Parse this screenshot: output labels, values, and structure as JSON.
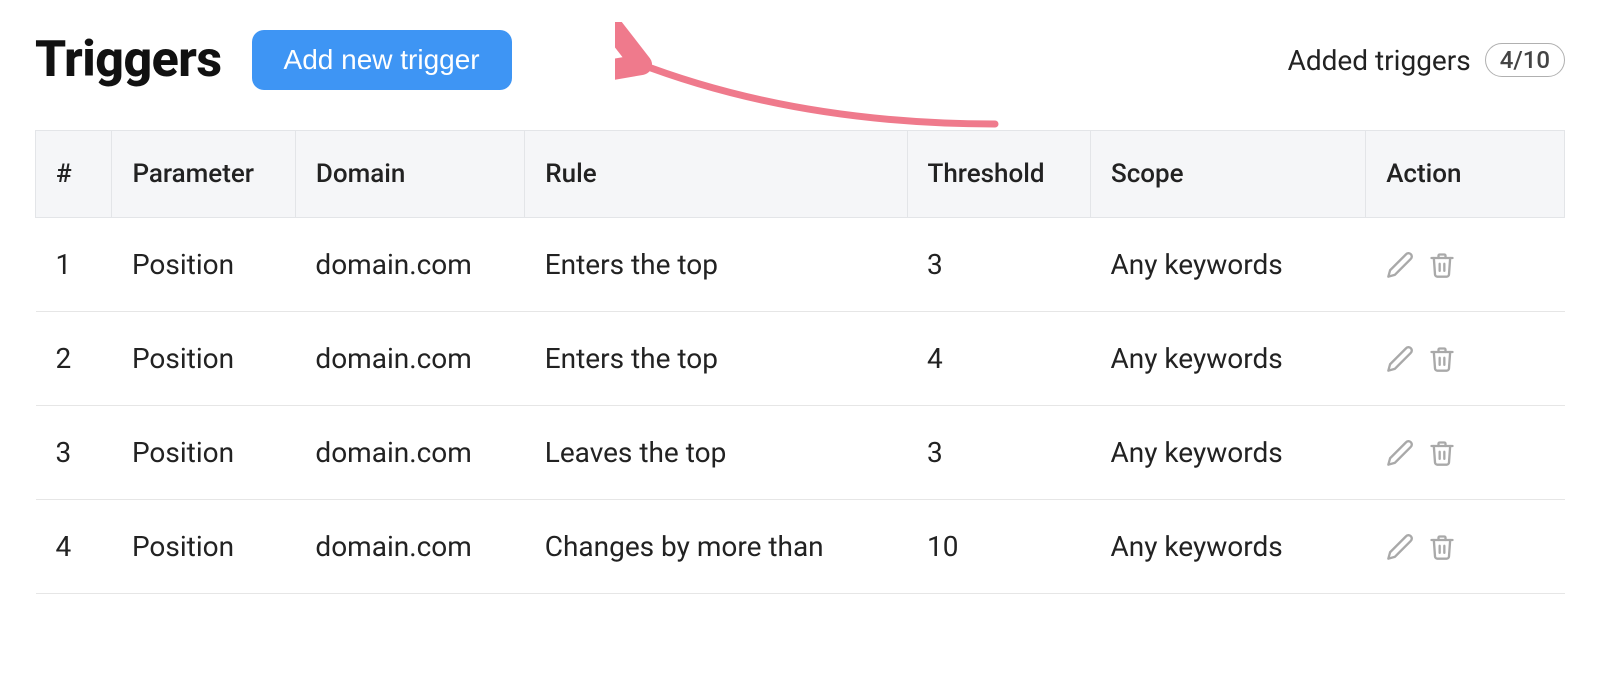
{
  "header": {
    "title": "Triggers",
    "add_button_label": "Add new trigger",
    "added_label": "Added triggers",
    "added_count": "4/10"
  },
  "table": {
    "headers": {
      "num": "#",
      "parameter": "Parameter",
      "domain": "Domain",
      "rule": "Rule",
      "threshold": "Threshold",
      "scope": "Scope",
      "action": "Action"
    },
    "rows": [
      {
        "num": "1",
        "parameter": "Position",
        "domain": "domain.com",
        "rule": "Enters the top",
        "threshold": "3",
        "scope": "Any keywords"
      },
      {
        "num": "2",
        "parameter": "Position",
        "domain": "domain.com",
        "rule": "Enters the top",
        "threshold": "4",
        "scope": "Any keywords"
      },
      {
        "num": "3",
        "parameter": "Position",
        "domain": "domain.com",
        "rule": "Leaves the top",
        "threshold": "3",
        "scope": "Any keywords"
      },
      {
        "num": "4",
        "parameter": "Position",
        "domain": "domain.com",
        "rule": "Changes by more than",
        "threshold": "10",
        "scope": "Any keywords"
      }
    ]
  },
  "colors": {
    "accent_blue": "#3e95f4",
    "annotation_pink": "#ef7a8c",
    "icon_gray": "#a9a9a9"
  }
}
